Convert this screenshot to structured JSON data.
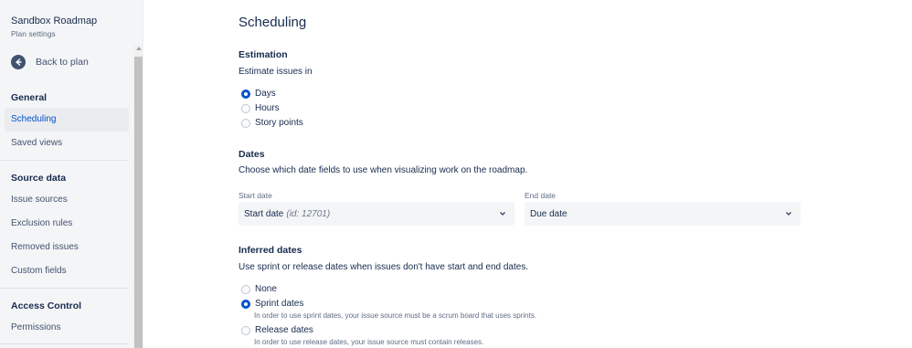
{
  "sidebar": {
    "title": "Sandbox Roadmap",
    "subtitle": "Plan settings",
    "back_label": "Back to plan",
    "sections": [
      {
        "label": "General",
        "items": [
          "Scheduling",
          "Saved views"
        ]
      },
      {
        "label": "Source data",
        "items": [
          "Issue sources",
          "Exclusion rules",
          "Removed issues",
          "Custom fields"
        ]
      },
      {
        "label": "Access Control",
        "items": [
          "Permissions"
        ]
      }
    ],
    "active_item": "Scheduling"
  },
  "main": {
    "title": "Scheduling",
    "estimation": {
      "heading": "Estimation",
      "prompt": "Estimate issues in",
      "options": [
        "Days",
        "Hours",
        "Story points"
      ],
      "selected": "Days"
    },
    "dates": {
      "heading": "Dates",
      "description": "Choose which date fields to use when visualizing work on the roadmap.",
      "start_label": "Start date",
      "start_value": "Start date",
      "start_value_hint": "(id: 12701)",
      "end_label": "End date",
      "end_value": "Due date"
    },
    "inferred": {
      "heading": "Inferred dates",
      "description": "Use sprint or release dates when issues don't have start and end dates.",
      "options": [
        {
          "label": "None",
          "help": ""
        },
        {
          "label": "Sprint dates",
          "help": "In order to use sprint dates, your issue source must be a scrum board that uses sprints."
        },
        {
          "label": "Release dates",
          "help": "In order to use release dates, your issue source must contain releases."
        }
      ],
      "selected": "Sprint dates"
    }
  },
  "colors": {
    "accent": "#0052cc",
    "text": "#172b4d",
    "sidebar_bg": "#f4f5f7"
  }
}
